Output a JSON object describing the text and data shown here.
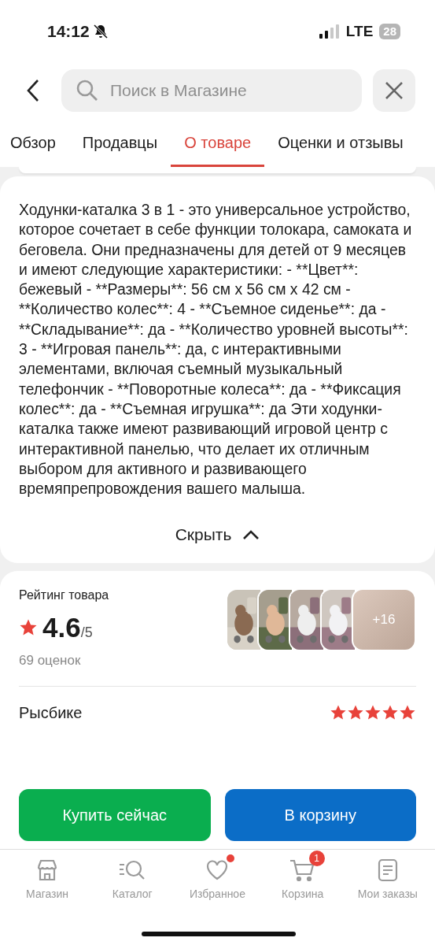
{
  "status_bar": {
    "time": "14:12",
    "network": "LTE",
    "battery": "28"
  },
  "search": {
    "placeholder": "Поиск в Магазине"
  },
  "tabs": [
    {
      "label": "Обзор",
      "selected": false
    },
    {
      "label": "Продавцы",
      "selected": false
    },
    {
      "label": "О товаре",
      "selected": true
    },
    {
      "label": "Оценки и отзывы",
      "selected": false
    }
  ],
  "description": {
    "text": "Ходунки-каталка 3 в 1 - это универсальное устройство, которое сочетает в себе функции толокара, самоката и беговела. Они предназначены для детей от 9 месяцев и имеют следующие характеристики: - **Цвет**: бежевый - **Размеры**: 56 см x 56 см x 42 см - **Количество колес**: 4 - **Съемное сиденье**: да - **Складывание**: да - **Количество уровней высоты**: 3 - **Игровая панель**: да, с интерактивными элементами, включая съемный музыкальный телефончик - **Поворотные колеса**: да - **Фиксация колес**: да - **Съемная игрушка**: да Эти ходунки-каталка также имеют развивающий игровой центр с интерактивной панелью, что делает их отличным выбором для активного и развивающего времяпрепровождения вашего малыша.",
    "toggle": "Скрыть"
  },
  "rating": {
    "title": "Рейтинг товара",
    "score": "4.6",
    "scale": "/5",
    "count": "69 оценок",
    "more": "+16"
  },
  "review": {
    "author": "Рысбике",
    "stars": 5
  },
  "buttons": [
    {
      "kind": "buy",
      "label": "Купить сейчас"
    },
    {
      "kind": "cart",
      "label": "В корзину"
    }
  ],
  "nav": [
    {
      "kind": "shop",
      "label": "Магазин",
      "dot": false
    },
    {
      "kind": "catalog",
      "label": "Каталог",
      "dot": false
    },
    {
      "kind": "favorites",
      "label": "Избранное",
      "dot": true
    },
    {
      "kind": "cart",
      "label": "Корзина",
      "dot": false,
      "badge": "1"
    },
    {
      "kind": "orders",
      "label": "Мои заказы",
      "dot": false
    }
  ]
}
